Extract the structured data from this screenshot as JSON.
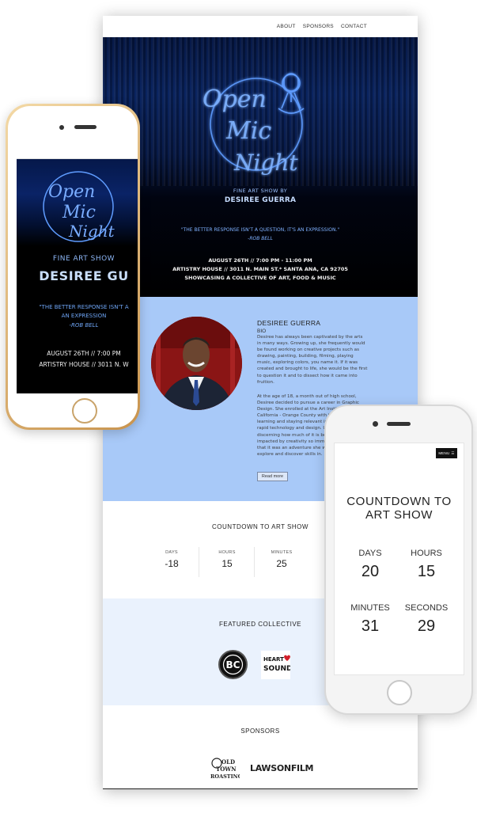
{
  "nav": {
    "items": [
      "ABOUT",
      "SPONSORS",
      "CONTACT"
    ]
  },
  "hero": {
    "logo_text": [
      "Open",
      "Mic",
      "Night"
    ],
    "subtitle": "FINE ART SHOW BY",
    "name": "DESIREE GUERRA",
    "quote": "\"THE BETTER RESPONSE ISN'T A QUESTION, IT'S AN EXPRESSION.\"",
    "quote_author": "-ROB BELL",
    "date": "AUGUST 26TH // 7:00 PM - 11:00 PM",
    "address": "ARTISTRY HOUSE // 3011 N. MAIN ST.* SANTA ANA, CA 92705",
    "showcase": "SHOWCASING A COLLECTIVE OF ART, FOOD & MUSIC"
  },
  "bio": {
    "title": "DESIREE GUERRA",
    "label": "BIO",
    "p1": "Desiree has always been captivated by the arts in many ways. Growing up, she frequently would be found working on creative projects such as drawing, painting, building, filming, playing music, exploring colors, you name it. If it was created and brought to life, she would be the first to question it and to dissect how it came into fruition.",
    "p2": "At the age of 18, a month out of high school, Desiree decided to pursue a career in Graphic Design. She enrolled at the Art Institute of California - Orange County with the intention of learning and staying relevant in today's culture of rapid technology and design. Using the world and discerning how much of it is being greatly impacted by creativity so immensely, she knew that it was an adventure she wanted to share, explore and discover skills in.",
    "read_more": "Read more"
  },
  "countdown": {
    "title": "COUNTDOWN TO ART SHOW",
    "cells": [
      {
        "label": "DAYS",
        "value": "-18"
      },
      {
        "label": "HOURS",
        "value": "15"
      },
      {
        "label": "MINUTES",
        "value": "25"
      }
    ]
  },
  "featured": {
    "title": "FEATURED COLLECTIVE",
    "logos": [
      {
        "text": "BC"
      },
      {
        "text": [
          "HEART",
          "SOUND"
        ]
      }
    ]
  },
  "sponsors": {
    "title": "SPONSORS",
    "logos": [
      {
        "text": [
          "OLD",
          "TOWN",
          "ROASTING"
        ]
      },
      {
        "text": "LAWSONFILM"
      }
    ]
  },
  "phone_left": {
    "subtitle": "FINE ART SHOW",
    "name": "DESIREE GU",
    "quote1": "\"THE BETTER RESPONSE ISN'T A",
    "quote2": "AN EXPRESSION",
    "quote_author": "-ROB BELL",
    "date": "AUGUST 26TH // 7:00 PM",
    "address": "ARTISTRY HOUSE // 3011 N. W"
  },
  "phone_right": {
    "menu": "MENU",
    "title_line1": "COUNTDOWN TO",
    "title_line2": "ART SHOW",
    "cells": [
      {
        "label": "DAYS",
        "value": "20"
      },
      {
        "label": "HOURS",
        "value": "15"
      },
      {
        "label": "MINUTES",
        "value": "31"
      },
      {
        "label": "SECONDS",
        "value": "29"
      }
    ]
  },
  "colors": {
    "bio_bg": "#a8c9f8",
    "neon": "#6ea4f4",
    "featured_bg": "#eaf2fd"
  }
}
